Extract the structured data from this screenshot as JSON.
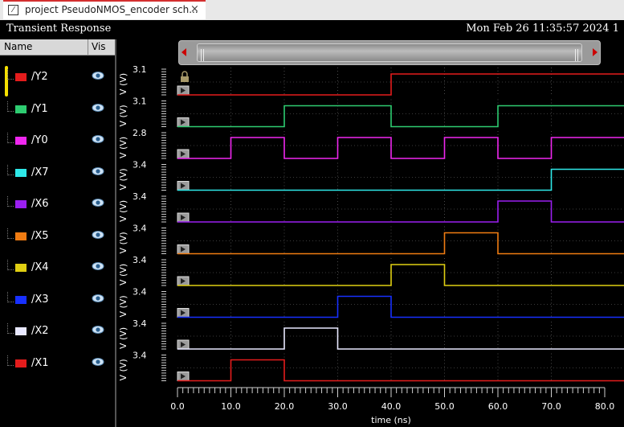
{
  "tab": {
    "title": "project PseudoNMOS_encoder sch...",
    "close": "×"
  },
  "window": {
    "title": "Transient Response",
    "datetime": "Mon Feb 26 11:35:57 2024",
    "page": "1"
  },
  "list": {
    "col_name": "Name",
    "col_vis": "Vis",
    "signals": [
      {
        "name": "/Y2",
        "color": "#e41c1c",
        "ymax": "3.1"
      },
      {
        "name": "/Y1",
        "color": "#2ecc71",
        "ymax": "3.1"
      },
      {
        "name": "/Y0",
        "color": "#ef27ef",
        "ymax": "2.8"
      },
      {
        "name": "/X7",
        "color": "#2ee8e8",
        "ymax": "3.4"
      },
      {
        "name": "/X6",
        "color": "#9b1ff0",
        "ymax": "3.4"
      },
      {
        "name": "/X5",
        "color": "#f07c12",
        "ymax": "3.4"
      },
      {
        "name": "/X4",
        "color": "#e0cf12",
        "ymax": "3.4"
      },
      {
        "name": "/X3",
        "color": "#1730ff",
        "ymax": "3.4"
      },
      {
        "name": "/X2",
        "color": "#e8e8ff",
        "ymax": "3.4"
      },
      {
        "name": "/X1",
        "color": "#e41c1c",
        "ymax": "3.4"
      }
    ]
  },
  "chart_data": {
    "type": "line",
    "xlabel": "time (ns)",
    "ylabel": "V (V)",
    "xlim": [
      0,
      80
    ],
    "xticks": [
      "0.0",
      "10.0",
      "20.0",
      "30.0",
      "40.0",
      "50.0",
      "60.0",
      "70.0",
      "80.0"
    ],
    "series": [
      {
        "name": "/Y2",
        "color": "#e41c1c",
        "ymax": 3.1,
        "x": [
          0,
          40,
          40,
          80
        ],
        "y": [
          0,
          0,
          1,
          1
        ]
      },
      {
        "name": "/Y1",
        "color": "#2ecc71",
        "ymax": 3.1,
        "x": [
          0,
          20,
          20,
          40,
          40,
          60,
          60,
          80
        ],
        "y": [
          0,
          0,
          1,
          1,
          0,
          0,
          1,
          1
        ]
      },
      {
        "name": "/Y0",
        "color": "#ef27ef",
        "ymax": 2.8,
        "x": [
          0,
          10,
          10,
          20,
          20,
          30,
          30,
          40,
          40,
          50,
          50,
          60,
          60,
          70,
          70,
          80
        ],
        "y": [
          0,
          0,
          1,
          1,
          0,
          0,
          1,
          1,
          0,
          0,
          1,
          1,
          0,
          0,
          1,
          1
        ]
      },
      {
        "name": "/X7",
        "color": "#2ee8e8",
        "ymax": 3.4,
        "x": [
          0,
          70,
          70,
          80
        ],
        "y": [
          0,
          0,
          1,
          1
        ]
      },
      {
        "name": "/X6",
        "color": "#9b1ff0",
        "ymax": 3.4,
        "x": [
          0,
          60,
          60,
          70,
          70,
          80
        ],
        "y": [
          0,
          0,
          1,
          1,
          0,
          0
        ]
      },
      {
        "name": "/X5",
        "color": "#f07c12",
        "ymax": 3.4,
        "x": [
          0,
          50,
          50,
          60,
          60,
          80
        ],
        "y": [
          0,
          0,
          1,
          1,
          0,
          0
        ]
      },
      {
        "name": "/X4",
        "color": "#e0cf12",
        "ymax": 3.4,
        "x": [
          0,
          40,
          40,
          50,
          50,
          80
        ],
        "y": [
          0,
          0,
          1,
          1,
          0,
          0
        ]
      },
      {
        "name": "/X3",
        "color": "#1730ff",
        "ymax": 3.4,
        "x": [
          0,
          30,
          30,
          40,
          40,
          80
        ],
        "y": [
          0,
          0,
          1,
          1,
          0,
          0
        ]
      },
      {
        "name": "/X2",
        "color": "#e8e8ff",
        "ymax": 3.4,
        "x": [
          0,
          20,
          20,
          30,
          30,
          80
        ],
        "y": [
          0,
          0,
          1,
          1,
          0,
          0
        ]
      },
      {
        "name": "/X1",
        "color": "#e41c1c",
        "ymax": 3.4,
        "x": [
          0,
          10,
          10,
          20,
          20,
          80
        ],
        "y": [
          0,
          0,
          1,
          1,
          0,
          0
        ]
      }
    ]
  }
}
